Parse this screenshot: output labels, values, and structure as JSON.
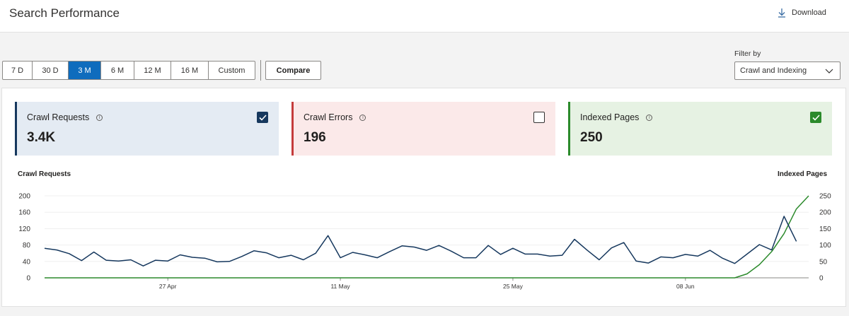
{
  "header": {
    "title": "Search Performance",
    "download_label": "Download"
  },
  "range_buttons": [
    {
      "label": "7 D",
      "active": false
    },
    {
      "label": "30 D",
      "active": false
    },
    {
      "label": "3 M",
      "active": true
    },
    {
      "label": "6 M",
      "active": false
    },
    {
      "label": "12 M",
      "active": false
    },
    {
      "label": "16 M",
      "active": false
    },
    {
      "label": "Custom",
      "active": false
    }
  ],
  "compare_label": "Compare",
  "filter": {
    "label": "Filter by",
    "value": "Crawl and Indexing"
  },
  "cards": [
    {
      "title": "Crawl Requests",
      "value": "3.4K",
      "checked": true,
      "accent": "#16385e",
      "bg": "#e4ebf3"
    },
    {
      "title": "Crawl Errors",
      "value": "196",
      "checked": false,
      "accent": "#c53b3b",
      "bg": "#fbe9e9"
    },
    {
      "title": "Indexed Pages",
      "value": "250",
      "checked": true,
      "accent": "#2b8a2b",
      "bg": "#e6f2e3"
    }
  ],
  "chart_data": {
    "type": "line",
    "left_axis_title": "Crawl Requests",
    "right_axis_title": "Indexed Pages",
    "left_ticks": [
      0,
      40,
      80,
      120,
      160,
      200
    ],
    "right_ticks": [
      0,
      50,
      100,
      150,
      200,
      250
    ],
    "x_tick_labels": [
      "27 Apr",
      "11 May",
      "25 May",
      "08 Jun"
    ],
    "x_tick_index": [
      10,
      24,
      38,
      52
    ],
    "series": [
      {
        "name": "Crawl Requests",
        "axis": "left",
        "color": "#16385e",
        "values": [
          72,
          68,
          59,
          42,
          63,
          43,
          41,
          44,
          29,
          43,
          41,
          56,
          50,
          48,
          39,
          40,
          52,
          66,
          61,
          49,
          55,
          44,
          60,
          103,
          49,
          62,
          56,
          49,
          64,
          78,
          75,
          67,
          79,
          65,
          49,
          49,
          79,
          57,
          72,
          58,
          58,
          53,
          55,
          94,
          68,
          44,
          73,
          86,
          41,
          36,
          51,
          49,
          57,
          53,
          67,
          48,
          35,
          58,
          81,
          68,
          150,
          89
        ]
      },
      {
        "name": "Indexed Pages",
        "axis": "right",
        "color": "#2b8a2b",
        "values": [
          0,
          0,
          0,
          0,
          0,
          0,
          0,
          0,
          0,
          0,
          0,
          0,
          0,
          0,
          0,
          0,
          0,
          0,
          0,
          0,
          0,
          0,
          0,
          0,
          0,
          0,
          0,
          0,
          0,
          0,
          0,
          0,
          0,
          0,
          0,
          0,
          0,
          0,
          0,
          0,
          0,
          0,
          0,
          0,
          0,
          0,
          0,
          0,
          0,
          0,
          0,
          0,
          0,
          0,
          0,
          0,
          0,
          12,
          40,
          80,
          135,
          210,
          250
        ]
      }
    ],
    "ylim_left": [
      0,
      200
    ],
    "ylim_right": [
      0,
      250
    ],
    "grid": true
  }
}
